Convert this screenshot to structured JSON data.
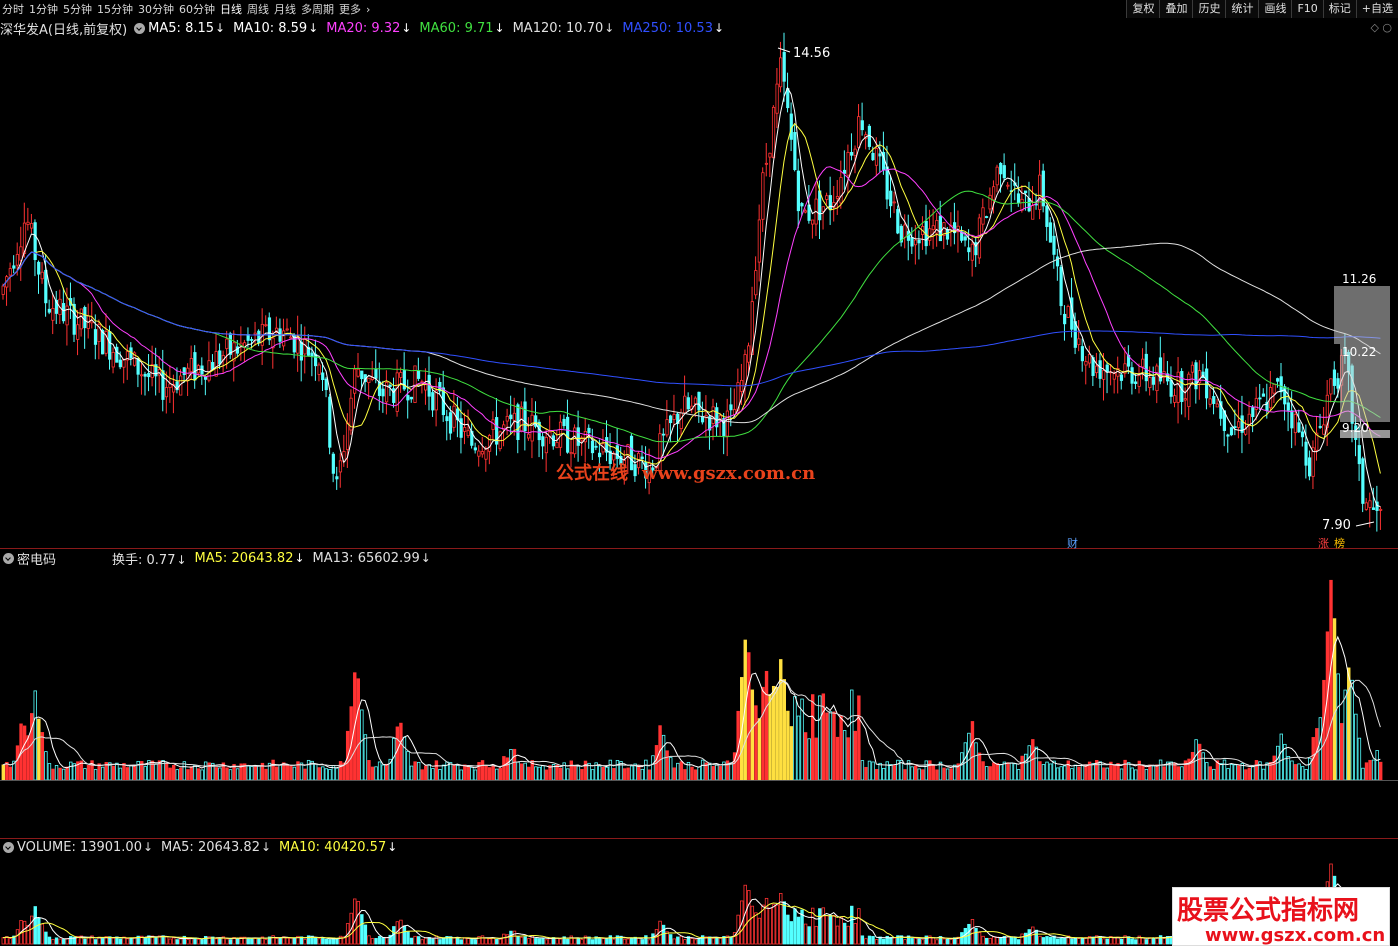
{
  "topbar": {
    "periods": [
      "分时",
      "1分钟",
      "5分钟",
      "15分钟",
      "30分钟",
      "60分钟",
      "日线",
      "周线",
      "月线",
      "多周期",
      "更多"
    ],
    "active_period": "日线",
    "tools": [
      "复权",
      "叠加",
      "历史",
      "统计",
      "画线",
      "F10",
      "标记",
      "+自选"
    ]
  },
  "main_legend": {
    "title": "深华发A(日线,前复权)",
    "ma5": "MA5: 8.15",
    "ma10": "MA10: 8.59",
    "ma20": "MA20: 9.32",
    "ma60": "MA60: 9.71",
    "ma120": "MA120: 10.70",
    "ma250": "MA250: 10.53",
    "colors": {
      "title": "#e0e0e0",
      "ma5": "#ffffff",
      "ma10": "#ffff40",
      "ma20": "#ff40ff",
      "ma60": "#40e040",
      "ma120": "#e0e0e0",
      "ma250": "#3050ff"
    }
  },
  "price_labels": {
    "high": "14.56",
    "low": "7.90",
    "level1": "11.26",
    "level2": "10.22",
    "level3": "9.20"
  },
  "tags": {
    "cai": "财",
    "zhang": "涨",
    "bang": "榜"
  },
  "turnover_legend": {
    "title": "密电码",
    "turnover": "换手: 0.77",
    "ma5": "MA5: 20643.82",
    "ma13": "MA13: 65602.99"
  },
  "volume_legend": {
    "title": "VOLUME: 13901.00",
    "ma5": "MA5: 20643.82",
    "ma10": "MA10: 40420.57"
  },
  "watermark": {
    "cn": "公式在线",
    "url": "www.gszx.com.cn"
  },
  "logo": {
    "line1": "股票公式指标网",
    "line2": "www.gszx.com.cn"
  },
  "colors": {
    "up": "#ff3232",
    "down": "#54ffff",
    "bg": "#000000",
    "highlight_vol": "#ffe040"
  }
}
